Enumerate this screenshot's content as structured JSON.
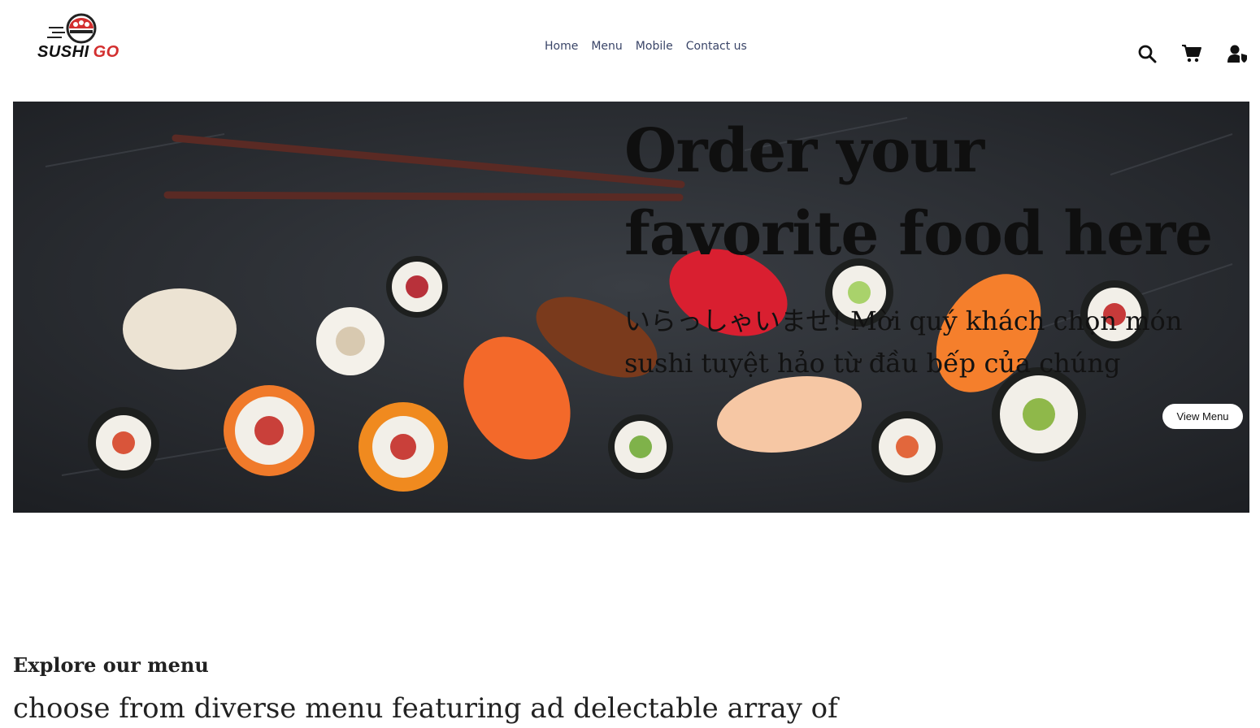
{
  "brand": {
    "word1": "SUSHI",
    "word2": "GO",
    "accent_color": "#d32f2f"
  },
  "nav": {
    "items": [
      {
        "label": "Home"
      },
      {
        "label": "Menu"
      },
      {
        "label": "Mobile"
      },
      {
        "label": "Contact us"
      }
    ]
  },
  "header_icons": {
    "search": "search-icon",
    "cart": "cart-icon",
    "account": "user-shield-icon"
  },
  "hero": {
    "title": "Order your favorite food here",
    "subtitle": "いらっしゃいませ! Mời quý khách chọn món sushi tuyệt hảo từ đầu bếp của chúng",
    "button_label": "View Menu"
  },
  "explore": {
    "title": "Explore our menu",
    "description": "choose from diverse menu featuring ad delectable array of"
  },
  "colors": {
    "nav_text": "#3a4568",
    "hero_bg": "#2a2d31"
  }
}
